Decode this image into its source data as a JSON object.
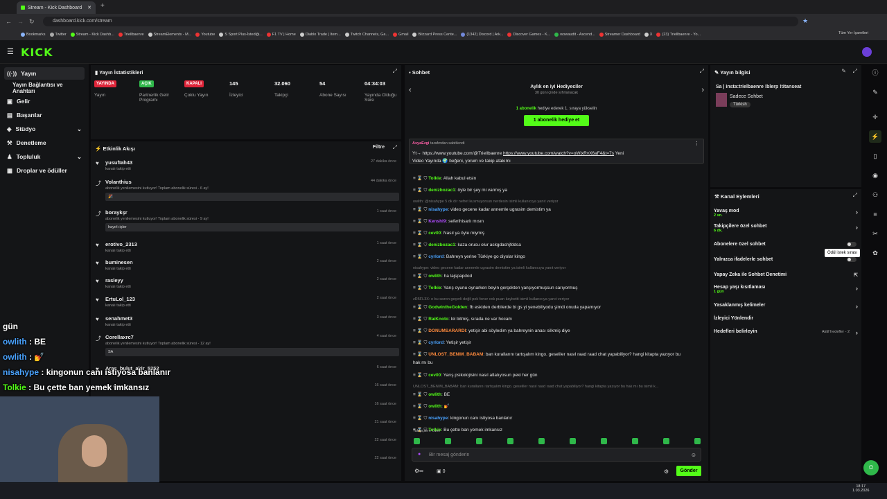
{
  "browser": {
    "tab_title": "Stream - Kick Dashboard",
    "url": "dashboard.kick.com/stream",
    "bookmarks": [
      "Bookmarks",
      "Twitter",
      "Stream - Kick Dashb...",
      "Triellbaenre",
      "StreamElements - M...",
      "Youtube",
      "S Sport Plus-İstediği...",
      "F1 TV | Home",
      "Diablo Trade | Item...",
      "Twitch Channels, Ga...",
      "Gmail",
      "Blizzard Press Cente...",
      "(1342) Discord | Ark...",
      "Discover Games - K...",
      "wowaudit - Ascend...",
      "Streamer Dashboard",
      "X",
      "(23) Triellbaenre - Yo..."
    ],
    "bookmarks_all": "Tüm Yer İşaretleri"
  },
  "brand": {
    "logo": "KICK",
    "accent": "#53fc18"
  },
  "sidebar": {
    "items": [
      {
        "label": "Yayın",
        "icon": "broadcast-icon"
      },
      {
        "label": "Yayın Bağlantısı ve Anahtarı",
        "icon": ""
      },
      {
        "label": "Gelir",
        "icon": "money-icon"
      },
      {
        "label": "Başarılar",
        "icon": "trophy-icon"
      },
      {
        "label": "Stüdyo",
        "icon": "studio-icon"
      },
      {
        "label": "Denetleme",
        "icon": "hammer-icon"
      },
      {
        "label": "Topluluk",
        "icon": "community-icon"
      },
      {
        "label": "Droplar ve ödüller",
        "icon": "gift-icon"
      }
    ]
  },
  "stats": {
    "title": "Yayın İstatistikleri",
    "items": [
      {
        "badge": "YAYINDA",
        "badge_color": "#e0253a",
        "label": "Yayın"
      },
      {
        "badge": "AÇIK",
        "badge_color": "#2fb84a",
        "label": "Partnerlik Gelir Programı"
      },
      {
        "badge": "KAPALI",
        "badge_color": "#e0253a",
        "label": "Çoklu Yayın"
      },
      {
        "value": "145",
        "label": "İzleyici"
      },
      {
        "value": "32.060",
        "label": "Takipçi"
      },
      {
        "value": "54",
        "label": "Abone Sayısı"
      },
      {
        "value": "04:34:03",
        "label": "Yayında Olduğu Süre"
      }
    ]
  },
  "activity": {
    "title": "Etkinlik Akışı",
    "filter": "Filtre",
    "events": [
      {
        "name": "yusufIah43",
        "sub": "kanalı takip etti",
        "time": "27 dakika önce",
        "msg": ""
      },
      {
        "name": "Volanthius",
        "sub": "abonelik yenilemesini kutluyor! Toplam abonelik süresi - 6 ay!",
        "time": "44 dakika önce",
        "msg": "🎉"
      },
      {
        "name": "boraykşr",
        "sub": "abonelik yenilemesini kutluyor! Toplam abonelik süresi - 9 ay!",
        "time": "1 saat önce",
        "msg": "hayırlı işler"
      },
      {
        "name": "erotivo_2313",
        "sub": "kanalı takip etti",
        "time": "1 saat önce",
        "msg": ""
      },
      {
        "name": "buminesen",
        "sub": "kanalı takip etti",
        "time": "2 saat önce",
        "msg": ""
      },
      {
        "name": "rasleyy",
        "sub": "kanalı takip etti",
        "time": "2 saat önce",
        "msg": ""
      },
      {
        "name": "ErtuLol_123",
        "sub": "kanalı takip etti",
        "time": "2 saat önce",
        "msg": ""
      },
      {
        "name": "senahmet3",
        "sub": "kanalı takip etti",
        "time": "3 saat önce",
        "msg": ""
      },
      {
        "name": "Corellaxrc7",
        "sub": "abonelik yenilemesini kutluyor! Toplam abonelik süresi - 12 ay!",
        "time": "4 saat önce",
        "msg": "SA"
      },
      {
        "name": "Aras_bulut_akir_5252",
        "sub": "",
        "time": "6 saat önce",
        "msg": ""
      },
      {
        "name": "",
        "sub": "den abone oldu!",
        "time": "16 saat önce",
        "msg": ""
      },
      {
        "name": "",
        "sub": "abone oldular",
        "time": "16 saat önce",
        "msg": ""
      },
      {
        "name": "",
        "sub": "",
        "time": "21 saat önce",
        "msg": ""
      },
      {
        "name": "",
        "sub": "",
        "time": "22 saat önce",
        "msg": ""
      },
      {
        "name": "",
        "sub": "",
        "time": "22 saat önce",
        "msg": ""
      }
    ]
  },
  "chat": {
    "title": "Sohbet",
    "gifters_title": "Aylık en iyi Hediyeciler",
    "gifters_sub": "30 gün içinde sıfırlanacak",
    "gift_hint_bold": "1 abonelik",
    "gift_hint": " hediye ederek 1. sıraya yükselin",
    "gift_button": "1 abonelik hediye et",
    "pinned_by": "AsyaEzgi",
    "pinned_suffix": " tarafından sabitlendi",
    "pinned_text1": "Yt→ https://www.youtube.com/@Triellbaenre ",
    "pinned_link2": "https://www.youtube.com/watch?v=oWixRvX6aF4&t=7s",
    "pinned_text2": " Yeni",
    "pinned_text3": "Video Yayında 🌍 beğeni, yorum ve takip atakımı",
    "messages": [
      {
        "type": "msg",
        "user": "Tolkie",
        "color": "#53fc18",
        "text": "Allah kabul etsin"
      },
      {
        "type": "msg",
        "user": "denizbozac1",
        "color": "#53fc18",
        "text": "öyle bir şey mi varmış ya"
      },
      {
        "type": "reply",
        "text": "owlith: @nisahype 5 dk dir nefret kusmuyorsun nerdesin isimli kullanıcıya yanıt veriyor"
      },
      {
        "type": "msg",
        "user": "nisahype",
        "color": "#4aa3ff",
        "text": "video gecene kadar annemle ugrasim demistim ya"
      },
      {
        "type": "msg",
        "user": "Kenshi9",
        "color": "#b04bff",
        "text": "seferihisarlı mısın"
      },
      {
        "type": "msg",
        "user": "cev00",
        "color": "#53fc18",
        "text": "Nasıl ya öyle miymiş"
      },
      {
        "type": "msg",
        "user": "denizbozac1",
        "color": "#53fc18",
        "text": "kaza orucu olur askgdashjfddsa"
      },
      {
        "type": "msg",
        "user": "cyrlord",
        "color": "#4aa3ff",
        "text": "Bahreyn yerine Türkiye go diyolar kingo"
      },
      {
        "type": "reply",
        "text": "nisahype: video gecene kadar annemle ugrasim demistim ya isimli kullanıcıya yanıt veriyor"
      },
      {
        "type": "msg",
        "user": "owlith",
        "color": "#53fc18",
        "text": "ha lajspapdod"
      },
      {
        "type": "msg",
        "user": "Tolkie",
        "color": "#53fc18",
        "text": "Yarış oyunu oynarken beyin gerçekten yanşıyormuşsun sarıyormuş"
      },
      {
        "type": "reply",
        "text": "zR5FL3X: o bu sezon geçerli değil pek fener cok puan kaybetti isimli kullanıcıya yanıt veriyor"
      },
      {
        "type": "msg",
        "user": "GodwintheGolden",
        "color": "#53fc18",
        "text": "fb eskiden derbilerde bi gs yi yenebiliyodu şimdi onuda yapamıyor"
      },
      {
        "type": "msg",
        "user": "RaiKnoto",
        "color": "#53fc18",
        "text": "lol bitmiş, sırada ne var hocam"
      },
      {
        "type": "msg",
        "user": "DONUMSARARDI",
        "color": "#ff8a3d",
        "text": "yetişir abi söyledim ya bahreynin anası silkmiş diye"
      },
      {
        "type": "msg",
        "user": "cyrlord",
        "color": "#4aa3ff",
        "text": "Yetişir yetişir"
      },
      {
        "type": "msg",
        "user": "UNLOST_BENIM_BABAM",
        "color": "#ff8a3d",
        "text": "ban kurallarını tartışalım kingo. geseliler nasıl raad raad chat yapabiliyor? hangi kitapta yazıyor bu"
      },
      {
        "type": "cont",
        "text": "hak mı bu"
      },
      {
        "type": "msg",
        "user": "cev00",
        "color": "#53fc18",
        "text": "Yarış psikolojisini nasıl atlatıyosun peki her gün"
      },
      {
        "type": "reply",
        "text": "UNLOST_BENIM_BABAM: ban kurallarını tartışalım kingo. geseliler nasıl raad raad chat yapabiliyor? hangi kitapta yazıyor bu hak mı bu isimli k..."
      },
      {
        "type": "msg",
        "user": "owlith",
        "color": "#53fc18",
        "text": "BE"
      },
      {
        "type": "msg",
        "user": "owlith",
        "color": "#53fc18",
        "text": "💅"
      },
      {
        "type": "msg",
        "user": "nisahype",
        "color": "#4aa3ff",
        "text": "kingonun canı istiyosa banlanır"
      },
      {
        "type": "msg",
        "user": "Tolkie",
        "color": "#53fc18",
        "text": "Bu çette ban yemek imkansız"
      }
    ],
    "followers_only": "Takipçilere Özel",
    "input_placeholder": "Bir mesaj gönderin",
    "count": "0",
    "send": "Gönder"
  },
  "stream_info": {
    "title": "Yayın bilgisi",
    "stream_title": "Sa | insta:trielbaenre !blerp !titanseat",
    "category": "Sadece Sohbet",
    "language": "Türkish"
  },
  "channel_actions": {
    "title": "Kanal Eylemleri",
    "items": [
      {
        "label": "Yavaş mod",
        "sub": "2 sn.",
        "control": "chevron"
      },
      {
        "label": "Takipçilere özel sohbet",
        "sub": "6 dk.",
        "control": "chevron"
      },
      {
        "label": "Abonelere özel sohbet",
        "sub": "",
        "control": "toggle"
      },
      {
        "label": "Yalnızca ifadelerle sohbet",
        "sub": "",
        "control": "toggle"
      },
      {
        "label": "Yapay Zeka ile Sohbet Denetimi",
        "sub": "",
        "control": "external"
      },
      {
        "label": "Hesap yaşı kısıtlaması",
        "sub": "1 gün",
        "control": "chevron"
      },
      {
        "label": "Yasaklanmış kelimeler",
        "sub": "",
        "control": "chevron"
      },
      {
        "label": "İzleyici Yönlendir",
        "sub": "",
        "control": ""
      },
      {
        "label": "Hedefleri belirleyin",
        "sub": "",
        "control": "chevron",
        "status": "Aktif hedefler - 2"
      }
    ],
    "tooltip": "Ödül istek sırası"
  },
  "overlay": {
    "lines": [
      {
        "user": "",
        "text": "gün",
        "color": "#ffffff"
      },
      {
        "user": "owlith",
        "text": " : BE",
        "color": "#4aa3ff"
      },
      {
        "user": "owlith",
        "text": " : 💅",
        "color": "#4aa3ff"
      },
      {
        "user": "nisahype",
        "text": " : kingonun canı istiyosa banlanır",
        "color": "#4aa3ff"
      },
      {
        "user": "Tolkie",
        "text": " : Bu çette ban yemek imkansız",
        "color": "#53fc18"
      }
    ]
  },
  "taskbar": {
    "time": "18:17",
    "date": "1.03.2026"
  }
}
